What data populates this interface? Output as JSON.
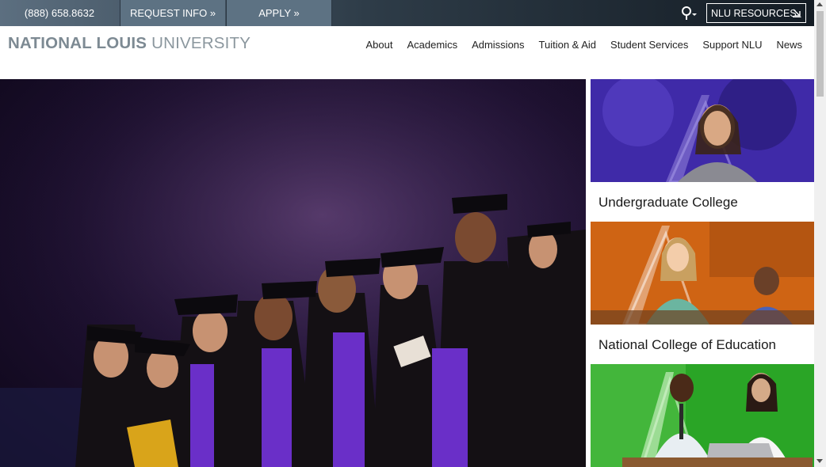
{
  "topbar": {
    "phone": "(888) 658.8632",
    "request_info": "REQUEST INFO »",
    "apply": "APPLY »",
    "resources": "NLU RESOURCES"
  },
  "logo": {
    "bold": "NATIONAL LOUIS",
    "light": "UNIVERSITY"
  },
  "nav": {
    "items": [
      "About",
      "Academics",
      "Admissions",
      "Tuition & Aid",
      "Student Services",
      "Support NLU",
      "News"
    ]
  },
  "cards": [
    {
      "title": "Undergraduate College"
    },
    {
      "title": "National College of Education"
    },
    {
      "title": ""
    }
  ],
  "colors": {
    "topbar_dark": "#141c24",
    "topbar_button": "#5d7283",
    "card_purple": "#4a2fb0",
    "card_orange": "#d9691b",
    "card_green": "#2ea82a"
  }
}
